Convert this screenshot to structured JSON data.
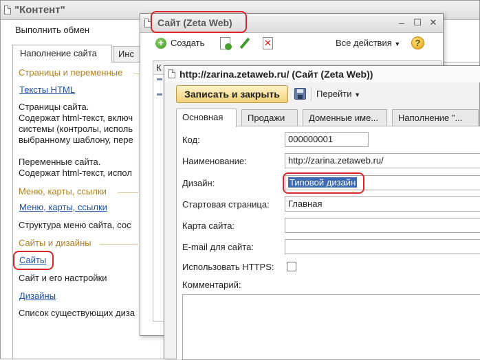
{
  "win1": {
    "title": "\"Контент\"",
    "exchange_label": "Выполнить обмен",
    "tabs": [
      {
        "label": "Наполнение сайта"
      },
      {
        "label": "Инс"
      }
    ],
    "groups": {
      "pages": "Страницы и переменные",
      "menus": "Меню, карты, ссылки",
      "sites": "Сайты и дизайны"
    },
    "links": {
      "html_texts": "Тексты HTML",
      "menus": "Меню, карты, ссылки",
      "sites": "Сайты",
      "designs": "Дизайны"
    },
    "desc": {
      "pages_1": "Страницы сайта.",
      "pages_2": "Содержат html-текст, включ",
      "pages_3": "системы (контролы, исполь",
      "pages_4": "выбранному шаблону, пере",
      "vars_1": "Переменные сайта.",
      "vars_2": "Содержат html-текст, испол",
      "menus": "Структура меню сайта, сос",
      "sites": "Сайт и его настройки",
      "designs": "Список существующих диза"
    }
  },
  "win2": {
    "title": "Сайт (Zeta Web)",
    "create_label": "Создать",
    "all_actions_label": "Все действия",
    "list_col": "К"
  },
  "win3": {
    "title": "http://zarina.zetaweb.ru/ (Сайт (Zeta Web))",
    "save_close_label": "Записать и закрыть",
    "goto_label": "Перейти",
    "tabs": [
      {
        "label": "Основная"
      },
      {
        "label": "Продажи"
      },
      {
        "label": "Доменные име..."
      },
      {
        "label": "Наполнение \"..."
      }
    ],
    "fields": {
      "code_label": "Код:",
      "code_value": "000000001",
      "name_label": "Наименование:",
      "name_value": "http://zarina.zetaweb.ru/",
      "design_label": "Дизайн:",
      "design_value": "Типовой дизайн",
      "start_label": "Стартовая страница:",
      "start_value": "Главная",
      "sitemap_label": "Карта сайта:",
      "sitemap_value": "",
      "email_label": "E-mail для сайта:",
      "email_value": "",
      "https_label": "Использовать HTTPS:",
      "https_checked": false,
      "comment_label": "Комментарий:",
      "comment_value": ""
    }
  },
  "colors": {
    "link": "#1d4fa8",
    "group_heading": "#b08020",
    "highlight_circle": "#d8262b",
    "selection": "#3d6bb3",
    "primary_button": "#f1d27a"
  }
}
